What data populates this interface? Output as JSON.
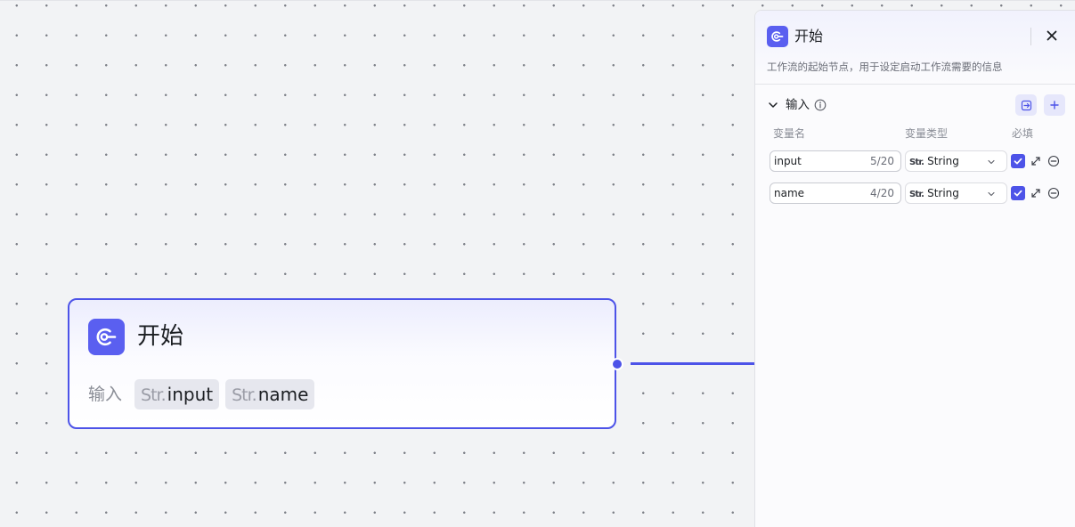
{
  "canvas": {
    "node": {
      "title": "开始",
      "icon": "start-node-icon",
      "inputs_label": "输入",
      "inputs": [
        {
          "type_prefix": "Str.",
          "name": "input"
        },
        {
          "type_prefix": "Str.",
          "name": "name"
        }
      ]
    }
  },
  "panel": {
    "title": "开始",
    "icon": "start-node-icon",
    "description": "工作流的起始节点，用于设定启动工作流需要的信息",
    "close_icon": "close-icon",
    "section": {
      "title": "输入",
      "columns": {
        "name": "变量名",
        "type": "变量类型",
        "required": "必填"
      },
      "variables": [
        {
          "name": "input",
          "count": "5/20",
          "type_prefix": "Str.",
          "type": "String",
          "required": true
        },
        {
          "name": "name",
          "count": "4/20",
          "type_prefix": "Str.",
          "type": "String",
          "required": true
        }
      ]
    }
  },
  "colors": {
    "accent": "#4d53e8",
    "canvas_bg": "#f2f3f5",
    "panel_bg": "#fbfbfd"
  }
}
